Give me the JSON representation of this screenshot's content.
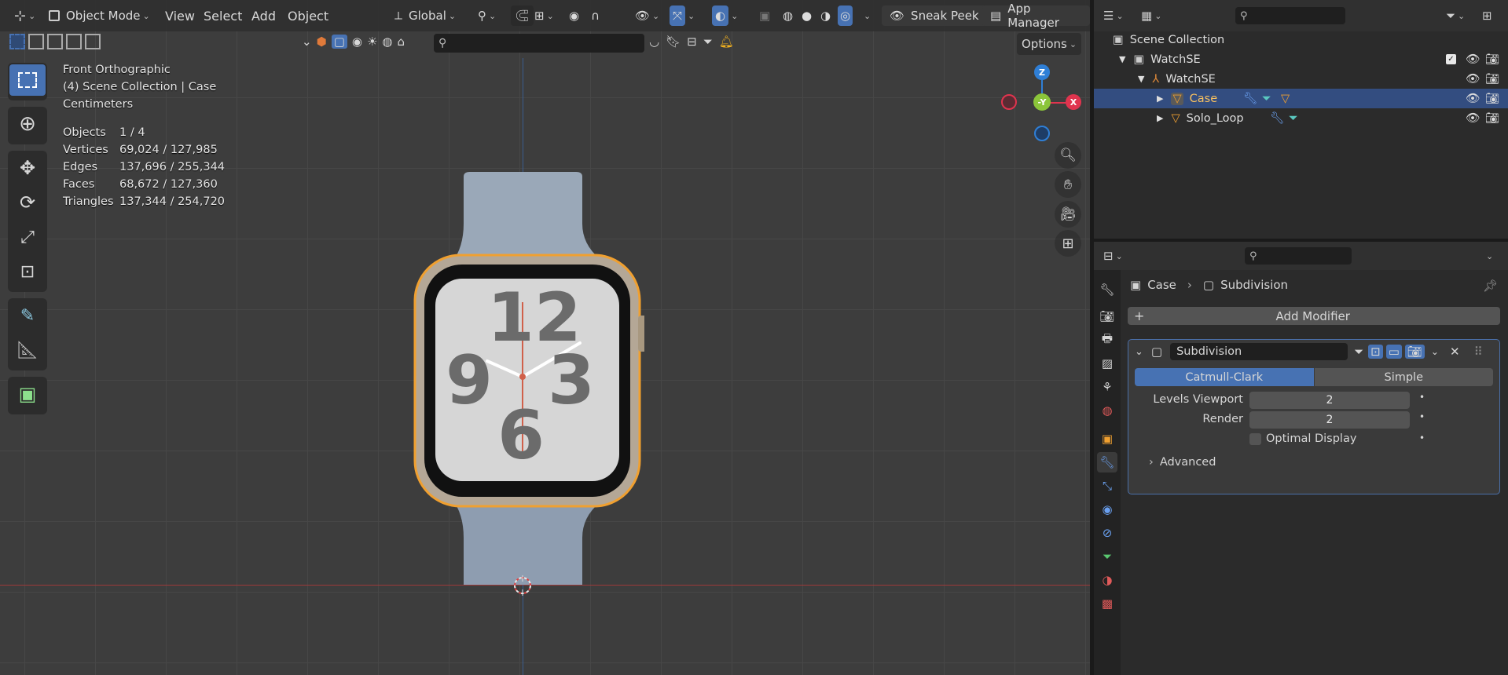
{
  "viewport": {
    "mode": "Object Mode",
    "menus": [
      "View",
      "Select",
      "Add",
      "Object"
    ],
    "transform_orientation": "Global",
    "sneak_peek": "Sneak Peek",
    "app_manager": "App Manager",
    "options": "Options",
    "view_name": "Front Orthographic",
    "collection_info": "(4) Scene Collection | Case",
    "units": "Centimeters",
    "stats": [
      {
        "label": "Objects",
        "value": "1 / 4"
      },
      {
        "label": "Vertices",
        "value": "69,024 / 127,985"
      },
      {
        "label": "Edges",
        "value": "137,696 / 255,344"
      },
      {
        "label": "Faces",
        "value": "68,672 / 127,360"
      },
      {
        "label": "Triangles",
        "value": "137,344 / 254,720"
      }
    ],
    "gizmo": {
      "z": "Z",
      "y": "-Y",
      "x": "X"
    },
    "watch_face": {
      "top": "12",
      "left": "9",
      "right": "3",
      "bottom": "6"
    }
  },
  "outliner": {
    "root": "Scene Collection",
    "items": [
      {
        "name": "WatchSE",
        "type": "collection"
      },
      {
        "name": "WatchSE",
        "type": "armature"
      },
      {
        "name": "Case",
        "type": "mesh",
        "selected": true
      },
      {
        "name": "Solo_Loop",
        "type": "mesh"
      }
    ]
  },
  "properties": {
    "breadcrumb_object": "Case",
    "breadcrumb_modifier": "Subdivision",
    "add_modifier": "Add Modifier",
    "modifier_name": "Subdivision",
    "type_options": [
      "Catmull-Clark",
      "Simple"
    ],
    "selected_type": "Catmull-Clark",
    "levels_viewport_label": "Levels Viewport",
    "levels_viewport_value": "2",
    "render_label": "Render",
    "render_value": "2",
    "optimal_display": "Optimal Display",
    "advanced": "Advanced"
  },
  "colors": {
    "accent": "#4772b3",
    "selection_outline": "#f0a030",
    "axis_x": "#e0344e",
    "axis_y": "#8bc53a",
    "axis_z": "#2f7fd6"
  }
}
